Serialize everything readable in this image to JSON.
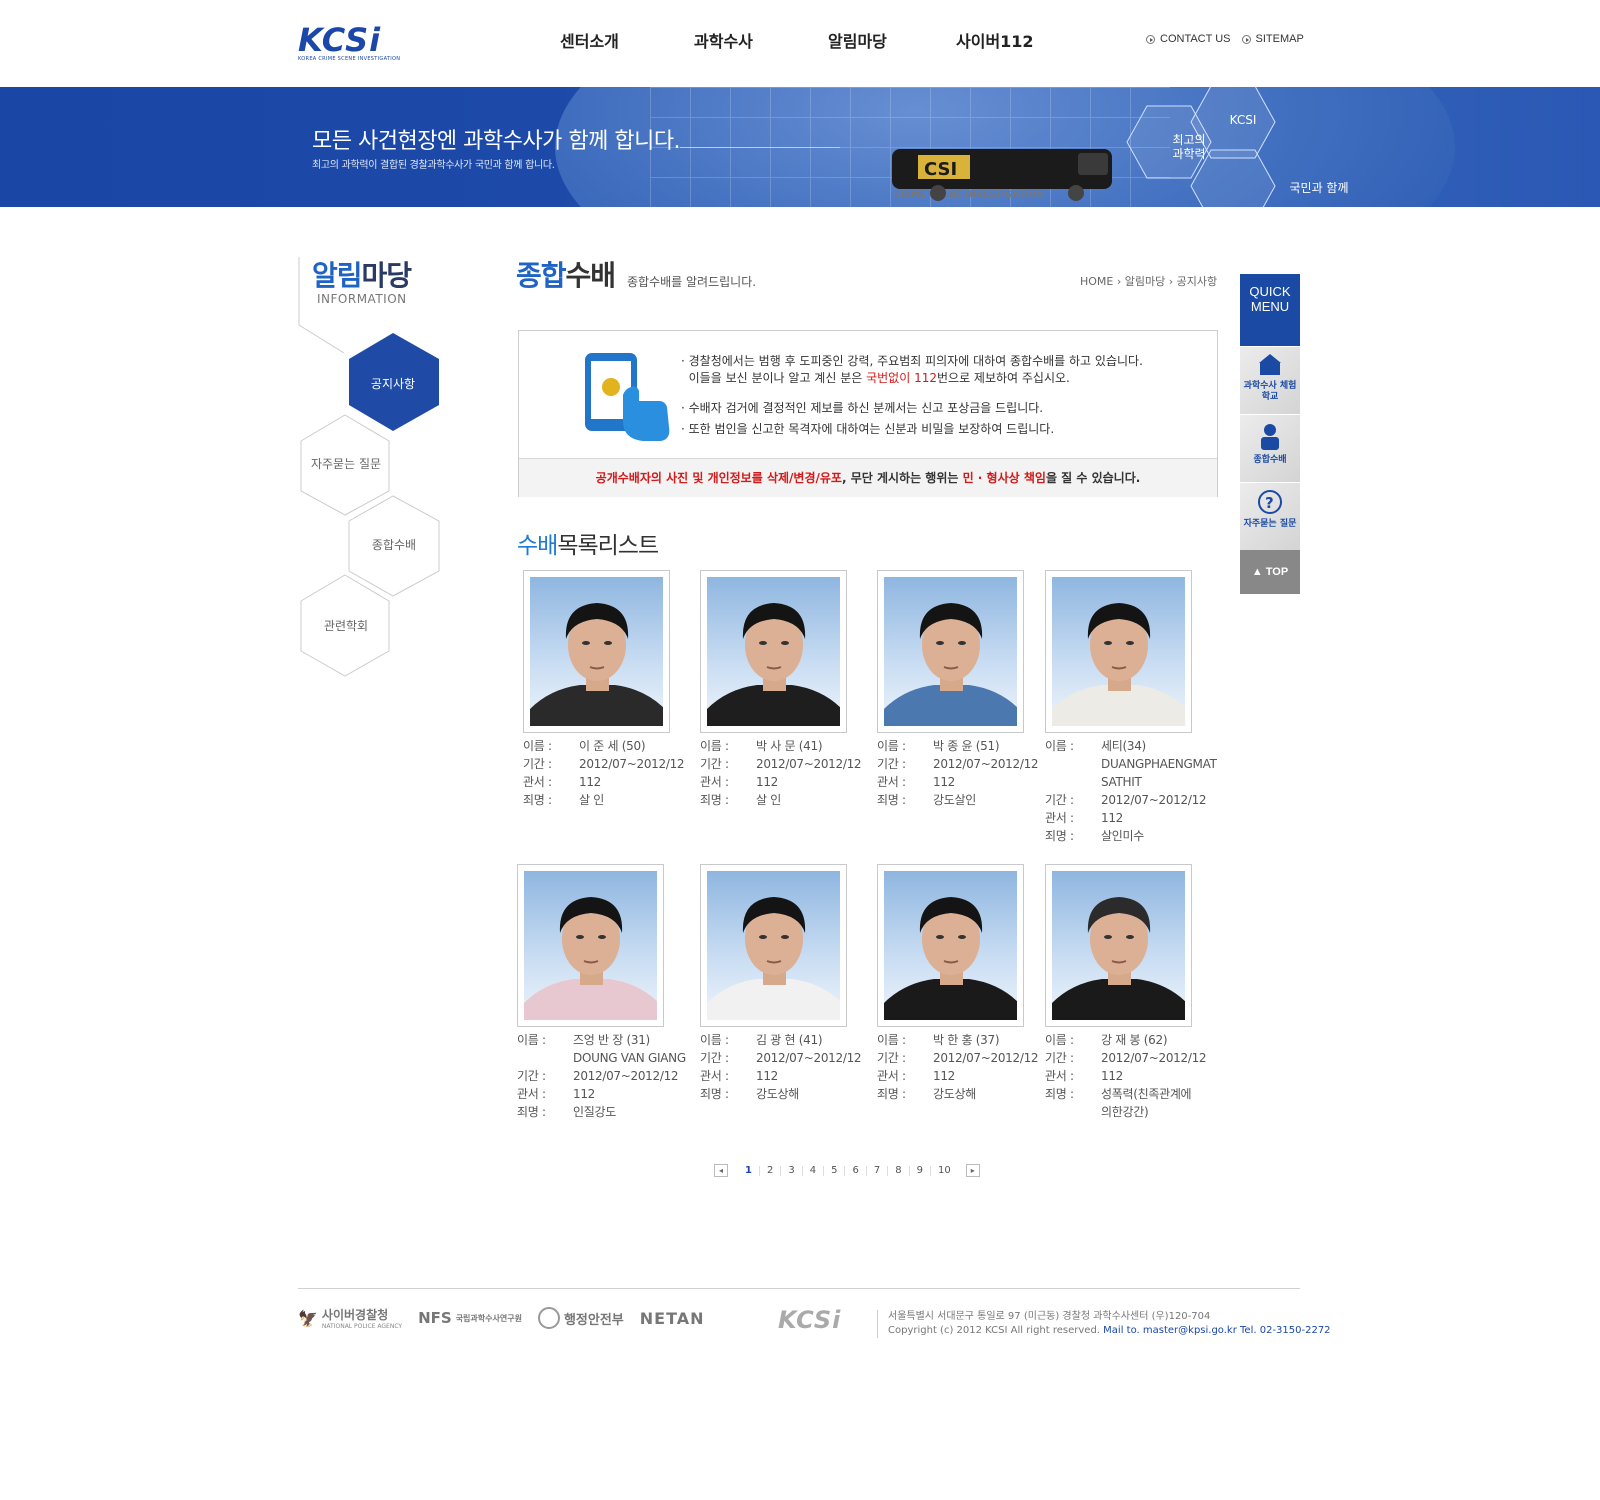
{
  "header": {
    "logo": "KCSi",
    "logo_sub": "KOREA CRIME SCENE INVESTIGATION",
    "nav": [
      "센터소개",
      "과학수사",
      "알림마당",
      "사이버112"
    ],
    "util": [
      "CONTACT US",
      "SITEMAP"
    ]
  },
  "banner": {
    "title": "모든 사건현장엔 과학수사가 함께 합니다.",
    "subtitle": "최고의 과학력이 결합된 경찰과학수사가 국민과 함께 합니다.",
    "hex1": "KCSI",
    "hex2a": "최고의",
    "hex2b": "과학력",
    "hex3": "국민과 함께"
  },
  "lnb": {
    "title_blue": "알림",
    "title_rest": "마당",
    "sub": "INFORMATION",
    "items": [
      "공지사항",
      "자주묻는 질문",
      "종합수배",
      "관련학회"
    ]
  },
  "content": {
    "title_blue": "종합",
    "title_rest": "수배",
    "subtitle": "종합수배를 알려드립니다.",
    "breadcrumb": "HOME › 알림마당 › 공지사항",
    "notice": {
      "line1": "· 경찰청에서는 범행 후 도피중인 강력, 주요범죄 피의자에 대하여 종합수배를 하고 있습니다.",
      "line2a": "이들을 보신 분이나 알고 계신 분은 ",
      "line2_red": "국번없이 112",
      "line2b": "번으로 제보하여 주십시오.",
      "line3": "· 수배자 검거에 결정적인 제보를 하신 분께서는 신고 포상금을 드립니다.",
      "line4": "· 또한 범인을 신고한 목격자에 대하여는 신분과 비밀을 보장하여 드립니다.",
      "bar_red": "공개수배자의 사진 및 개인정보를 삭제/변경/유포",
      "bar_mid": ", 무단 게시하는 행위는 ",
      "bar_red2": "민 · 형사상 책임",
      "bar_end": "을 질 수 있습니다."
    },
    "list_title_blue": "수배",
    "list_title_rest": "목록리스트",
    "labels": {
      "name": "이름 :",
      "period": "기간 :",
      "office": "관서 :",
      "crime": "죄명 :"
    },
    "suspects": [
      {
        "name": "이 준 세 (50)",
        "name2": "",
        "period": "2012/07~2012/12",
        "office": "112",
        "crime": "살 인",
        "crime2": ""
      },
      {
        "name": "박 사 문 (41)",
        "name2": "",
        "period": "2012/07~2012/12",
        "office": "112",
        "crime": "살 인",
        "crime2": ""
      },
      {
        "name": "박 종 윤 (51)",
        "name2": "",
        "period": "2012/07~2012/12",
        "office": "112",
        "crime": "강도살인",
        "crime2": ""
      },
      {
        "name": "세티(34)",
        "name2": "DUANGPHAENGMAT SATHIT",
        "period": "2012/07~2012/12",
        "office": "112",
        "crime": "살인미수",
        "crime2": ""
      },
      {
        "name": "즈엉 반 장 (31)",
        "name2": "DOUNG VAN GIANG",
        "period": "2012/07~2012/12",
        "office": "112",
        "crime": "인질강도",
        "crime2": ""
      },
      {
        "name": "김 광 현 (41)",
        "name2": "",
        "period": "2012/07~2012/12",
        "office": "112",
        "crime": "강도상해",
        "crime2": ""
      },
      {
        "name": "박 한 홍 (37)",
        "name2": "",
        "period": "2012/07~2012/12",
        "office": "112",
        "crime": "강도상해",
        "crime2": ""
      },
      {
        "name": "강 재 봉 (62)",
        "name2": "",
        "period": "2012/07~2012/12",
        "office": "112",
        "crime": "성폭력(친족관계에",
        "crime2": "의한강간)"
      }
    ],
    "pages": [
      "1",
      "2",
      "3",
      "4",
      "5",
      "6",
      "7",
      "8",
      "9",
      "10"
    ]
  },
  "quick": {
    "head": "QUICK MENU",
    "items": [
      "과학수사 체험학교",
      "종합수배",
      "자주묻는 질문"
    ],
    "top": "▲ TOP"
  },
  "footer": {
    "logos": [
      "사이버경찰청",
      "NATIONAL POLICE AGENCY",
      "NFS",
      "국립과학수사연구원",
      "행정안전부",
      "NETAN"
    ],
    "kcsi": "KCSi",
    "address": "서울특별시 서대문구 통일로 97 (미근동) 경찰청 과학수사센터 (우)120-704",
    "copyright": "Copyright (c) 2012 KCSI All right reserved. ",
    "contact": "Mail to. master@kpsi.go.kr Tel. 02-3150-2272"
  }
}
